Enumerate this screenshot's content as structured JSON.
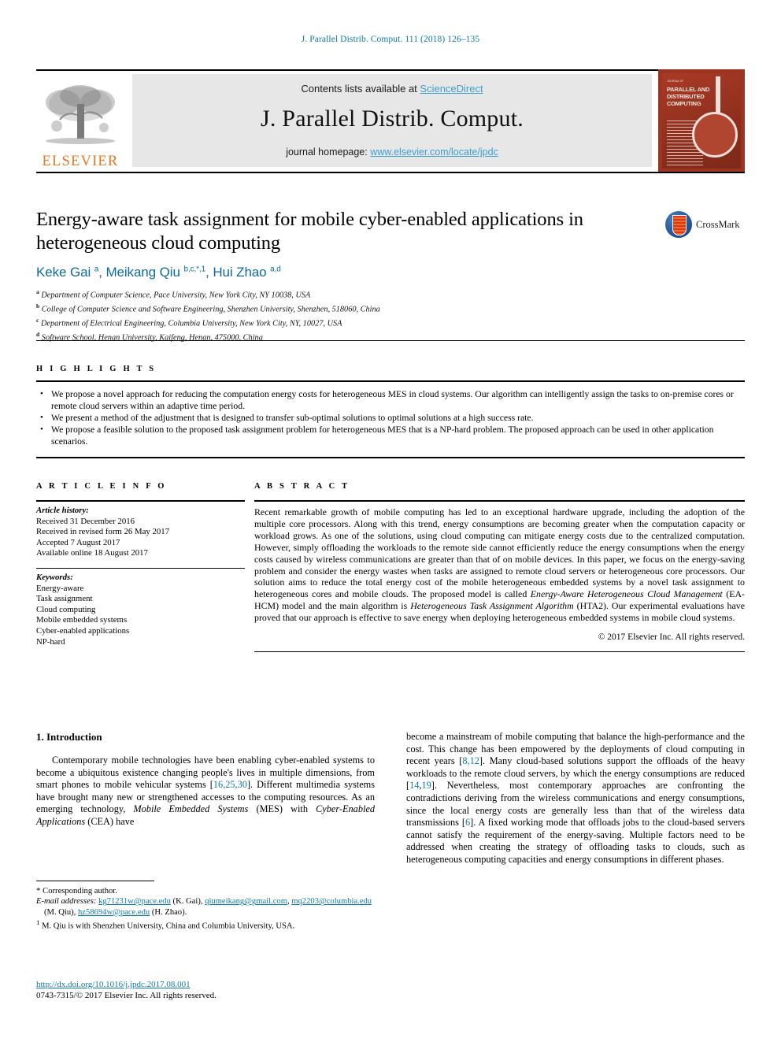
{
  "running_head": "J. Parallel Distrib. Comput. 111 (2018) 126–135",
  "masthead": {
    "contents_prefix": "Contents lists available at ",
    "sciencedirect": "ScienceDirect",
    "journal_title": "J. Parallel Distrib. Comput.",
    "homepage_prefix": "journal homepage: ",
    "homepage_url": "www.elsevier.com/locate/jpdc",
    "publisher_logo_text": "ELSEVIER",
    "cover_title": "PARALLEL AND DISTRIBUTED COMPUTING",
    "cover_kicker": "JOURNAL OF",
    "accent_blue": "#3a9fd0",
    "elsevier_orange": "#e87722",
    "cover_red": "#9c3422"
  },
  "article": {
    "title": "Energy-aware task assignment for mobile cyber-enabled applications in heterogeneous cloud computing",
    "authors_html": "Keke Gai <sup>a</sup>, Meikang Qiu <sup>b,c,*,1</sup>, Hui Zhao <sup>a,d</sup>",
    "crossmark_label": "CrossMark",
    "affiliations": [
      {
        "mark": "a",
        "text": "Department of Computer Science, Pace University, New York City, NY 10038, USA"
      },
      {
        "mark": "b",
        "text": "College of Computer Science and Software Engineering, Shenzhen University, Shenzhen, 518060, China"
      },
      {
        "mark": "c",
        "text": "Department of Electrical Engineering, Columbia University, New York City, NY, 10027, USA"
      },
      {
        "mark": "d",
        "text": "Software School, Henan University, Kaifeng, Henan, 475000, China"
      }
    ]
  },
  "highlights": {
    "heading": "H I G H L I G H T S",
    "items": [
      "We propose a novel approach for reducing the computation energy costs for heterogeneous MES in cloud systems. Our algorithm can intelligently assign the tasks to on-premise cores or remote cloud servers within an adaptive time period.",
      "We present a method of the adjustment that is designed to transfer sub-optimal solutions to optimal solutions at a high success rate.",
      "We propose a feasible solution to the proposed task assignment problem for heterogeneous MES that is a NP-hard problem. The proposed approach can be used in other application scenarios."
    ]
  },
  "article_info": {
    "heading": "A R T I C L E    I N F O",
    "history_label": "Article history:",
    "history": [
      "Received 31 December 2016",
      "Received in revised form 26 May 2017",
      "Accepted 7 August 2017",
      "Available online 18 August 2017"
    ],
    "keywords_label": "Keywords:",
    "keywords": [
      "Energy-aware",
      "Task assignment",
      "Cloud computing",
      "Mobile embedded systems",
      "Cyber-enabled applications",
      "NP-hard"
    ]
  },
  "abstract": {
    "heading": "A B S T R A C T",
    "paragraph_part1": "Recent remarkable growth of mobile computing has led to an exceptional hardware upgrade, including the adoption of the multiple core processors. Along with this trend, energy consumptions are becoming greater when the computation capacity or workload grows. As one of the solutions, using cloud computing can mitigate energy costs due to the centralized computation. However, simply offloading the workloads to the remote side cannot efficiently reduce the energy consumptions when the energy costs caused by wireless communications are greater than that of on mobile devices. In this paper, we focus on the energy-saving problem and consider the energy wastes when tasks are assigned to remote cloud servers or heterogeneous core processors. Our solution aims to reduce the total energy cost of the mobile heterogeneous embedded systems by a novel task assignment to heterogeneous cores and mobile clouds. The proposed model is called ",
    "italic1": "Energy-Aware Heterogeneous Cloud Management",
    "paragraph_part2": " (EA-HCM) model and the main algorithm is ",
    "italic2": "Heterogeneous Task Assignment Algorithm",
    "paragraph_part3": " (HTA2). Our experimental evaluations have proved that our approach is effective to save energy when deploying heterogeneous embedded systems in mobile cloud systems.",
    "copyright": "© 2017 Elsevier Inc. All rights reserved."
  },
  "body": {
    "section_number_title": "1. Introduction",
    "left_paragraph": {
      "t1": "Contemporary mobile technologies have been enabling cyber-enabled   systems to become a ubiquitous existence changing people's lives in multiple dimensions, from smart phones to mobile vehicular systems [",
      "ref1": "16,25,30",
      "t2": "]. Different multimedia systems have brought many new or strengthened accesses to the computing resources. As an emerging technology, ",
      "it1": "Mobile Embedded Systems",
      "t3": " (MES) with ",
      "it2": "Cyber-Enabled Applications",
      "t4": " (CEA) have"
    },
    "right_paragraph": {
      "t1": "become a mainstream of mobile computing that balance the high-performance and the cost. This change has been empowered by the deployments of cloud computing in recent years [",
      "ref1": "8,12",
      "t2": "]. Many cloud-based solutions support the offloads of the heavy workloads to the remote cloud servers, by which the energy consumptions are reduced [",
      "ref2": "14",
      "t3": ",",
      "ref3": "19",
      "t4": "]. Nevertheless, most contemporary approaches are confronting the contradictions deriving from the wireless communications and energy consumptions, since the local energy costs are generally less than that of the wireless data transmissions [",
      "ref4": "6",
      "t5": "]. A fixed working mode that offloads jobs to the cloud-based servers cannot satisfy the requirement of the energy-saving. Multiple factors need to be addressed when creating the strategy of offloading tasks to clouds, such as heterogeneous computing capacities and energy consumptions in different phases."
    }
  },
  "footnotes": {
    "corresponding": "Corresponding author.",
    "email_label": "E-mail addresses:",
    "email1": "kg71231w@pace.edu",
    "email1_attr": " (K. Gai), ",
    "email2": "qiumeikang@gmail.com",
    "email2_attr": ", ",
    "email3": "mq2203@columbia.edu",
    "email3_attr": " (M. Qiu), ",
    "email4": "hz58694w@pace.edu",
    "email4_attr": " (H. Zhao).",
    "footnote1_mark": "1",
    "footnote1": "M. Qiu is with Shenzhen University, China and Columbia University, USA."
  },
  "doi_block": {
    "doi": "http://dx.doi.org/10.1016/j.jpdc.2017.08.001",
    "issn_line": "0743-7315/© 2017 Elsevier Inc. All rights reserved."
  }
}
